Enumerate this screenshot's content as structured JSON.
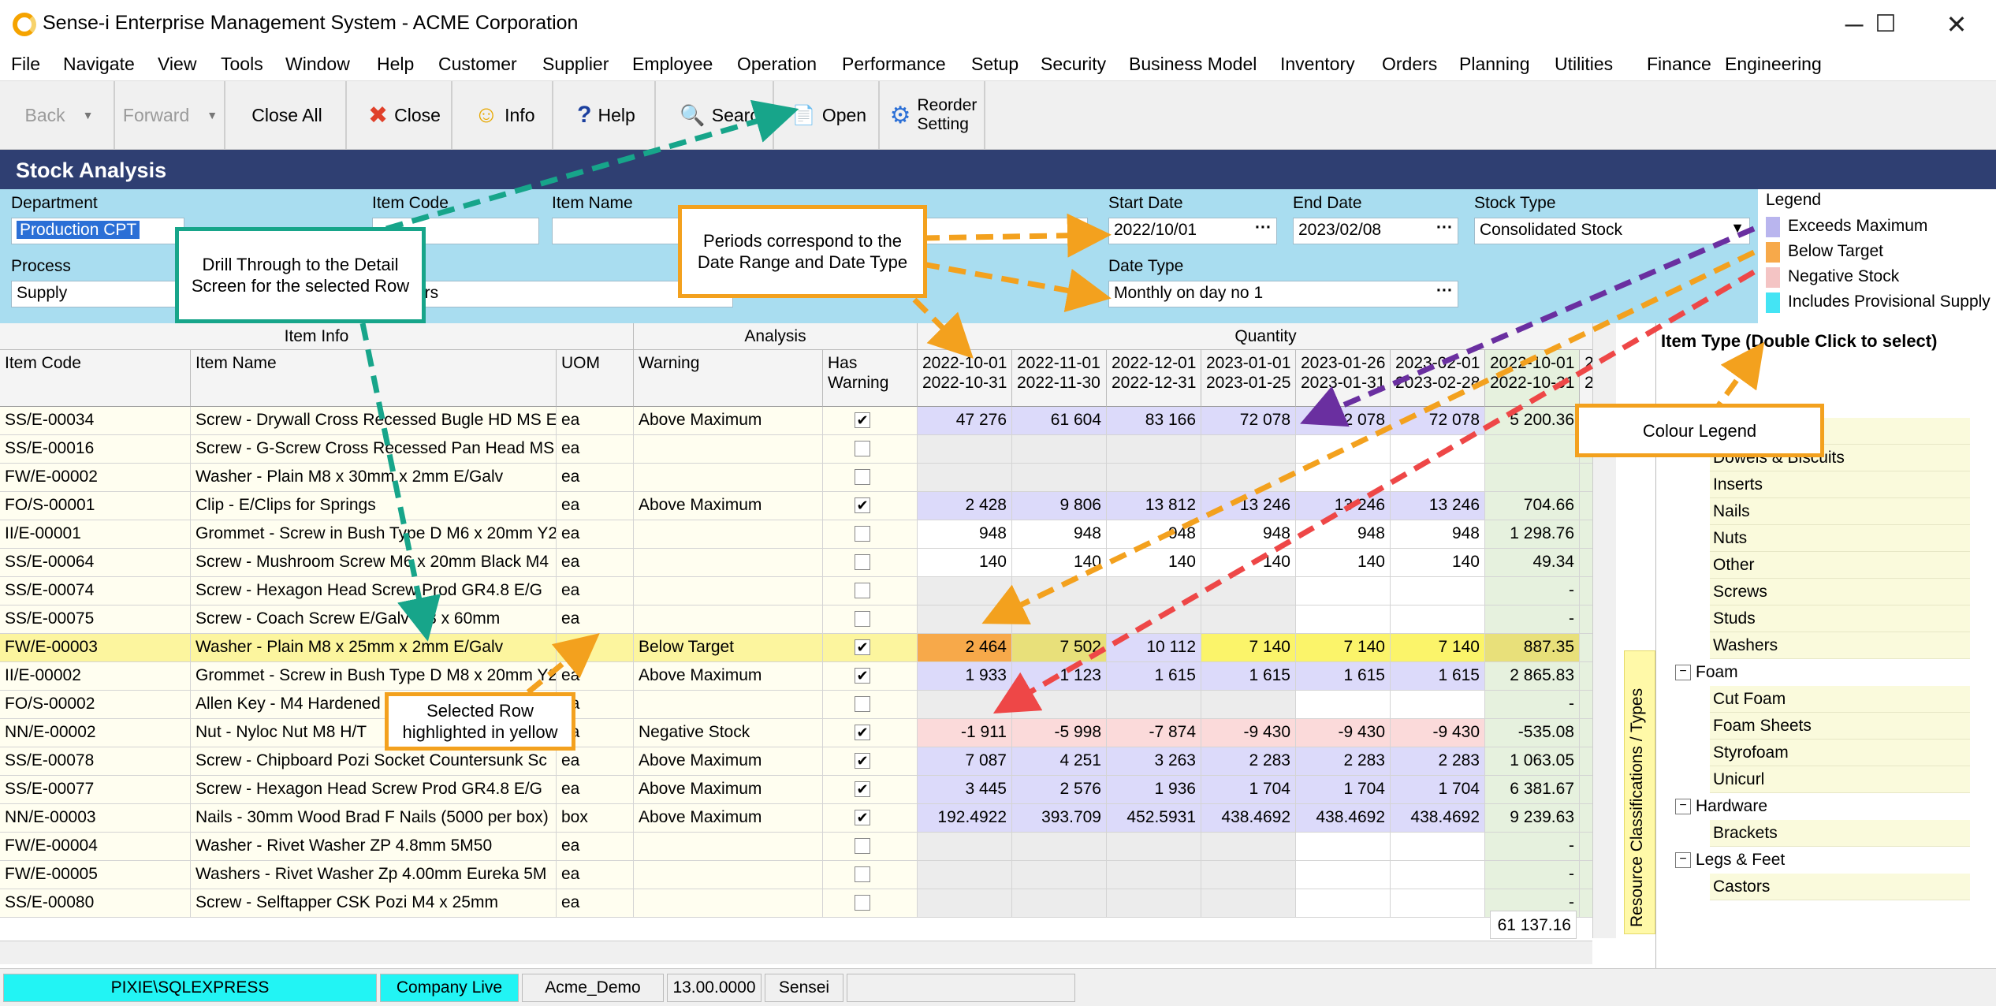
{
  "window": {
    "title": "Sense-i Enterprise Management System - ACME Corporation",
    "minimize": "─",
    "maximize": "☐",
    "close": "✕"
  },
  "menu": [
    "File",
    "Navigate",
    "View",
    "Tools",
    "Window",
    "Help",
    "Customer",
    "Supplier",
    "Employee",
    "Operation",
    "Performance",
    "Setup",
    "Security",
    "Business Model",
    "Inventory",
    "Orders",
    "Planning",
    "Utilities",
    "Finance",
    "Engineering"
  ],
  "toolbar": {
    "back": "Back",
    "forward": "Forward",
    "close_all": "Close All",
    "close": "Close",
    "info": "Info",
    "help": "Help",
    "search": "Search",
    "open": "Open",
    "reorder": "Reorder",
    "reorder2": "Setting",
    "icons": {
      "close": "✖",
      "info": "☺",
      "help": "?",
      "search": "🔍",
      "open": "📄",
      "reorder": "⚙"
    }
  },
  "screen": {
    "title": "Stock Analysis"
  },
  "filters": {
    "department_label": "Department",
    "department_value": "Production CPT",
    "item_code_label": "Item Code",
    "item_code_value": "",
    "item_name_label": "Item Name",
    "item_name_value": "",
    "start_date_label": "Start Date",
    "start_date_value": "2022/10/01",
    "end_date_label": "End Date",
    "end_date_value": "2023/02/08",
    "stock_type_label": "Stock Type",
    "stock_type_value": "Consolidated Stock",
    "process_label": "Process",
    "process_value": "Supply",
    "process2_value": "ers",
    "date_type_label": "Date Type",
    "date_type_value": "Monthly on day no 1"
  },
  "legend": {
    "title": "Legend",
    "items": [
      {
        "label": "Exceeds Maximum",
        "color": "#b9b5ee"
      },
      {
        "label": "Below Target",
        "color": "#f7a94a"
      },
      {
        "label": "Negative Stock",
        "color": "#f4c4c4"
      },
      {
        "label": "Includes Provisional Supply",
        "color": "#44e4f4"
      }
    ]
  },
  "grid": {
    "groups": {
      "item_info": "Item Info",
      "analysis": "Analysis",
      "quantity": "Quantity"
    },
    "headers": {
      "item_code": "Item Code",
      "item_name": "Item Name",
      "uom": "UOM",
      "warning": "Warning",
      "has_warning_1": "Has",
      "has_warning_2": "Warning"
    },
    "periods": [
      {
        "from": "2022-10-01",
        "to": "2022-10-31"
      },
      {
        "from": "2022-11-01",
        "to": "2022-11-30"
      },
      {
        "from": "2022-12-01",
        "to": "2022-12-31"
      },
      {
        "from": "2023-01-01",
        "to": "2023-01-25"
      },
      {
        "from": "2023-01-26",
        "to": "2023-01-31"
      },
      {
        "from": "2023-02-01",
        "to": "2023-02-28"
      },
      {
        "from": "2022-10-01",
        "to": "2022-10-31"
      },
      {
        "from": "2",
        "to": "2"
      }
    ],
    "rows": [
      {
        "code": "SS/E-00034",
        "name": "Screw - Drywall Cross Recessed Bugle HD MS E",
        "uom": "ea",
        "warning": "Above Maximum",
        "checked": true,
        "q": [
          "47 276",
          "61 604",
          "83 166",
          "72 078",
          "72 078",
          "72 078",
          "5 200.36"
        ],
        "hl": "max"
      },
      {
        "code": "SS/E-00016",
        "name": "Screw - G-Screw Cross Recessed Pan Head MS",
        "uom": "ea",
        "warning": "",
        "checked": false,
        "q": [
          "",
          "",
          "",
          "",
          "",
          "",
          ""
        ],
        "hl": "none"
      },
      {
        "code": "FW/E-00002",
        "name": "Washer - Plain M8 x 30mm x 2mm E/Galv",
        "uom": "ea",
        "warning": "",
        "checked": false,
        "q": [
          "",
          "",
          "",
          "",
          "",
          "",
          ""
        ],
        "hl": "none"
      },
      {
        "code": "FO/S-00001",
        "name": "Clip - E/Clips for Springs",
        "uom": "ea",
        "warning": "Above Maximum",
        "checked": true,
        "q": [
          "2 428",
          "9 806",
          "13 812",
          "13 246",
          "13 246",
          "13 246",
          "704.66"
        ],
        "hl": "max"
      },
      {
        "code": "II/E-00001",
        "name": "Grommet - Screw in Bush Type D M6 x 20mm Y2",
        "uom": "ea",
        "warning": "",
        "checked": false,
        "q": [
          "948",
          "948",
          "948",
          "948",
          "948",
          "948",
          "1 298.76"
        ],
        "hl": "none"
      },
      {
        "code": "SS/E-00064",
        "name": "Screw - Mushroom Screw M6 x 20mm Black M4",
        "uom": "ea",
        "warning": "",
        "checked": false,
        "q": [
          "140",
          "140",
          "140",
          "140",
          "140",
          "140",
          "49.34"
        ],
        "hl": "none"
      },
      {
        "code": "SS/E-00074",
        "name": "Screw - Hexagon Head Screw Prod GR4.8 E/G",
        "uom": "ea",
        "warning": "",
        "checked": false,
        "q": [
          "",
          "",
          "",
          "",
          "",
          "",
          "-"
        ],
        "hl": "none"
      },
      {
        "code": "SS/E-00075",
        "name": "Screw - Coach Screw E/Galv M8 x 60mm",
        "uom": "ea",
        "warning": "",
        "checked": false,
        "q": [
          "",
          "",
          "",
          "",
          "",
          "",
          "-"
        ],
        "hl": "none"
      },
      {
        "code": "FW/E-00003",
        "name": "Washer - Plain M8 x 25mm x 2mm E/Galv",
        "uom": "ea",
        "warning": "Below Target",
        "checked": true,
        "q": [
          "2 464",
          "7 502",
          "10 112",
          "7 140",
          "7 140",
          "7 140",
          "887.35"
        ],
        "hl": "selected"
      },
      {
        "code": "II/E-00002",
        "name": "Grommet - Screw in Bush Type D M8 x 20mm Y2",
        "uom": "ea",
        "warning": "Above Maximum",
        "checked": true,
        "q": [
          "1 933",
          "1 123",
          "1 615",
          "1 615",
          "1 615",
          "1 615",
          "2 865.83"
        ],
        "hl": "max"
      },
      {
        "code": "FO/S-00002",
        "name": "Allen Key - M4 Hardened",
        "uom": "ea",
        "warning": "",
        "checked": false,
        "q": [
          "",
          "",
          "",
          "",
          "",
          "",
          "-"
        ],
        "hl": "none"
      },
      {
        "code": "NN/E-00002",
        "name": "Nut - Nyloc Nut M8 H/T",
        "uom": "ea",
        "warning": "Negative Stock",
        "checked": true,
        "q": [
          "-1 911",
          "-5 998",
          "-7 874",
          "-9 430",
          "-9 430",
          "-9 430",
          "-535.08"
        ],
        "hl": "neg"
      },
      {
        "code": "SS/E-00078",
        "name": "Screw - Chipboard Pozi Socket Countersunk Sc",
        "uom": "ea",
        "warning": "Above Maximum",
        "checked": true,
        "q": [
          "7 087",
          "4 251",
          "3 263",
          "2 283",
          "2 283",
          "2 283",
          "1 063.05"
        ],
        "hl": "max"
      },
      {
        "code": "SS/E-00077",
        "name": "Screw - Hexagon Head Screw Prod GR4.8 E/G",
        "uom": "ea",
        "warning": "Above Maximum",
        "checked": true,
        "q": [
          "3 445",
          "2 576",
          "1 936",
          "1 704",
          "1 704",
          "1 704",
          "6 381.67"
        ],
        "hl": "max"
      },
      {
        "code": "NN/E-00003",
        "name": "Nails - 30mm Wood Brad F Nails (5000 per box)",
        "uom": "box",
        "warning": "Above Maximum",
        "checked": true,
        "q": [
          "192.4922",
          "393.709",
          "452.5931",
          "438.4692",
          "438.4692",
          "438.4692",
          "9 239.63"
        ],
        "hl": "max"
      },
      {
        "code": "FW/E-00004",
        "name": "Washer - Rivet Washer ZP 4.8mm 5M50",
        "uom": "ea",
        "warning": "",
        "checked": false,
        "q": [
          "",
          "",
          "",
          "",
          "",
          "",
          "-"
        ],
        "hl": "none"
      },
      {
        "code": "FW/E-00005",
        "name": "Washers - Rivet Washer Zp 4.00mm Eureka 5M",
        "uom": "ea",
        "warning": "",
        "checked": false,
        "q": [
          "",
          "",
          "",
          "",
          "",
          "",
          "-"
        ],
        "hl": "none"
      },
      {
        "code": "SS/E-00080",
        "name": "Screw - Selftapper CSK Pozi M4 x 25mm",
        "uom": "ea",
        "warning": "",
        "checked": false,
        "q": [
          "",
          "",
          "",
          "",
          "",
          "",
          "-"
        ],
        "hl": "none"
      }
    ],
    "total": "61 137.16"
  },
  "sidepanel": {
    "tab": "Resource Classifications / Types",
    "tree_header": "Item Type (Double Click to select)",
    "leaves1": [
      "Bolts",
      "Dowels & Biscuits",
      "Inserts",
      "Nails",
      "Nuts",
      "Other",
      "Screws",
      "Studs",
      "Washers"
    ],
    "foam": "Foam",
    "leaves2": [
      "Cut Foam",
      "Foam Sheets",
      "Styrofoam",
      "Unicurl"
    ],
    "hardware": "Hardware",
    "leaves3": [
      "Brackets"
    ],
    "legs": "Legs & Feet",
    "leaves4": [
      "Castors"
    ]
  },
  "status": {
    "server": "PIXIE\\SQLEXPRESS",
    "company": "Company Live",
    "db": "Acme_Demo",
    "version": "13.00.0000",
    "user": "Sensei"
  },
  "callouts": {
    "drill": "Drill Through to the Detail Screen for the selected Row",
    "periods": "Periods correspond to the Date Range and Date Type",
    "selected": "Selected Row highlighted in yellow",
    "colour": "Colour Legend"
  }
}
